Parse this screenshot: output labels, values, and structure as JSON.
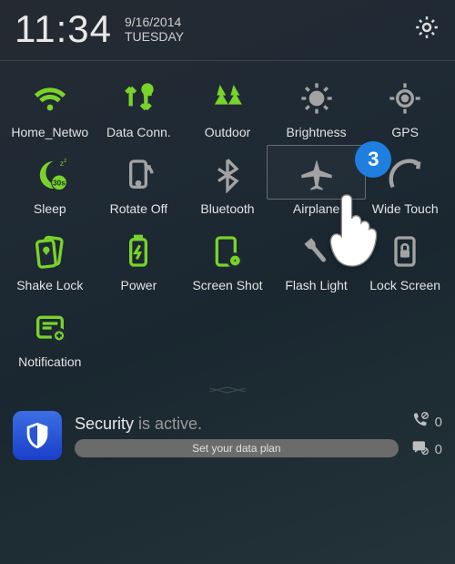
{
  "header": {
    "time": "11:34",
    "date": "9/16/2014",
    "day": "TUESDAY"
  },
  "tiles": [
    {
      "label": "Home_Netwo",
      "state": "green",
      "icon": "wifi"
    },
    {
      "label": "Data Conn.",
      "state": "green",
      "icon": "data"
    },
    {
      "label": "Outdoor",
      "state": "green",
      "icon": "outdoor"
    },
    {
      "label": "Brightness",
      "state": "grey",
      "icon": "brightness"
    },
    {
      "label": "GPS",
      "state": "grey",
      "icon": "gps"
    },
    {
      "label": "Sleep",
      "state": "green",
      "icon": "sleep"
    },
    {
      "label": "Rotate Off",
      "state": "grey",
      "icon": "rotate"
    },
    {
      "label": "Bluetooth",
      "state": "grey",
      "icon": "bluetooth"
    },
    {
      "label": "Airplane",
      "state": "grey",
      "icon": "airplane",
      "highlighted": true,
      "callout": "3"
    },
    {
      "label": "Wide Touch",
      "state": "grey",
      "icon": "widetouch"
    },
    {
      "label": "Shake Lock",
      "state": "green",
      "icon": "shakelock"
    },
    {
      "label": "Power",
      "state": "green",
      "icon": "power"
    },
    {
      "label": "Screen Shot",
      "state": "green",
      "icon": "screenshot"
    },
    {
      "label": "Flash Light",
      "state": "grey",
      "icon": "flashlight"
    },
    {
      "label": "Lock Screen",
      "state": "grey",
      "icon": "lockscreen"
    },
    {
      "label": "Notification",
      "state": "green",
      "icon": "notification"
    }
  ],
  "notification": {
    "app": "Security",
    "status": "is active.",
    "action": "Set your data plan",
    "missed_calls": "0",
    "missed_sms": "0"
  }
}
